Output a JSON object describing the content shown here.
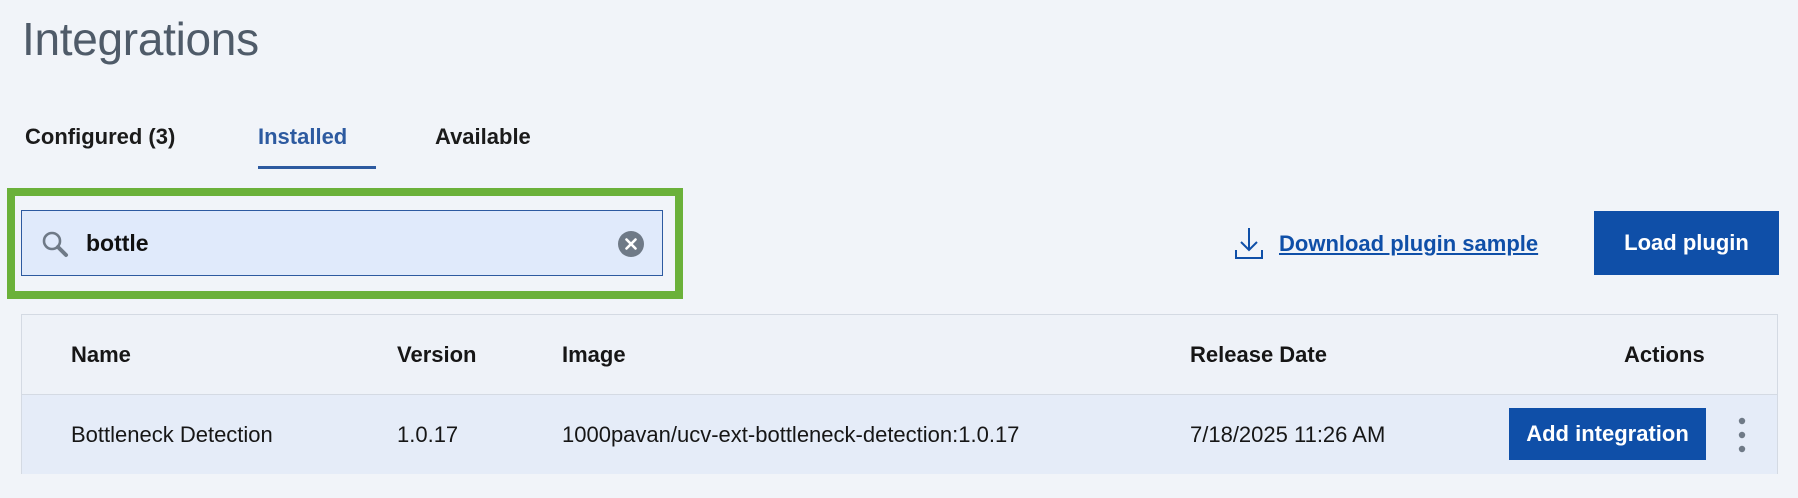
{
  "page": {
    "title": "Integrations"
  },
  "tabs": [
    {
      "label": "Configured (3)",
      "selected": false
    },
    {
      "label": "Installed",
      "selected": true
    },
    {
      "label": "Available",
      "selected": false
    }
  ],
  "search": {
    "value": "bottle",
    "icon": "search-icon",
    "clear_icon": "close-circle-icon"
  },
  "toolbar": {
    "download_label": "Download plugin sample",
    "download_icon": "download-icon",
    "load_label": "Load plugin"
  },
  "table": {
    "columns": [
      "Name",
      "Version",
      "Image",
      "Release Date",
      "Actions"
    ],
    "rows": [
      {
        "name": "Bottleneck Detection",
        "version": "1.0.17",
        "image": "1000pavan/ucv-ext-bottleneck-detection:1.0.17",
        "release_date": "7/18/2025 11:26 AM",
        "action_label": "Add integration"
      }
    ]
  },
  "colors": {
    "accent": "#0f4fa8",
    "tab_selected": "#2d5aa0",
    "highlight": "#6bb13a",
    "background": "#f1f4f9"
  }
}
